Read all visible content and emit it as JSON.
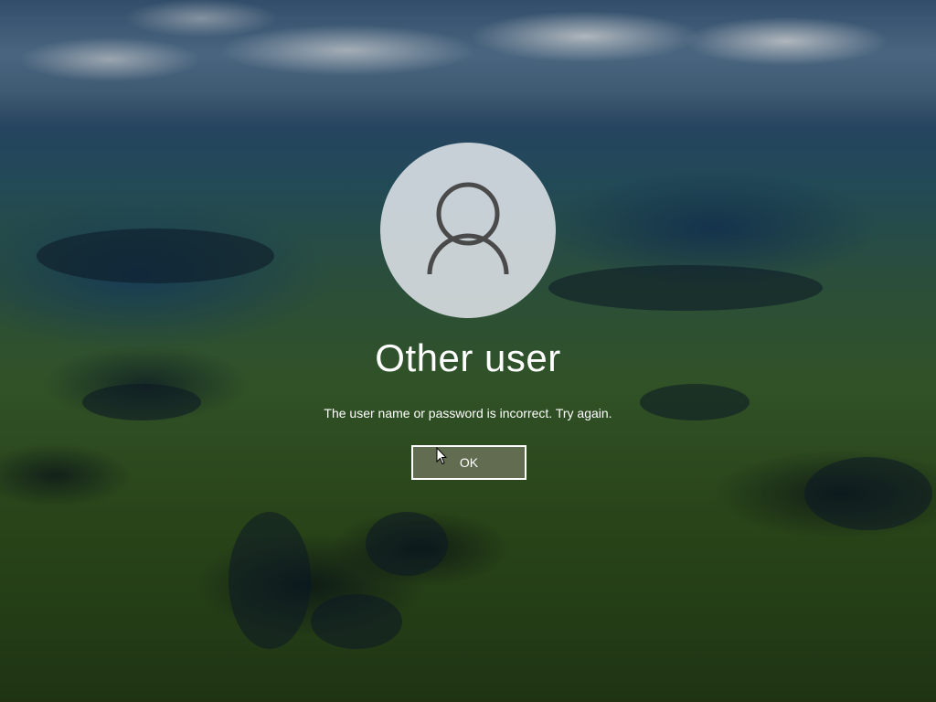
{
  "login": {
    "user_name": "Other user",
    "error_message": "The user name or password is incorrect. Try again.",
    "ok_label": "OK"
  },
  "icons": {
    "avatar": "user-silhouette-icon",
    "cursor": "mouse-pointer-icon"
  },
  "colors": {
    "text": "#ffffff",
    "avatar_bg": "#dee2e8",
    "avatar_icon": "#4a4a4a",
    "button_border": "#ffffff"
  }
}
